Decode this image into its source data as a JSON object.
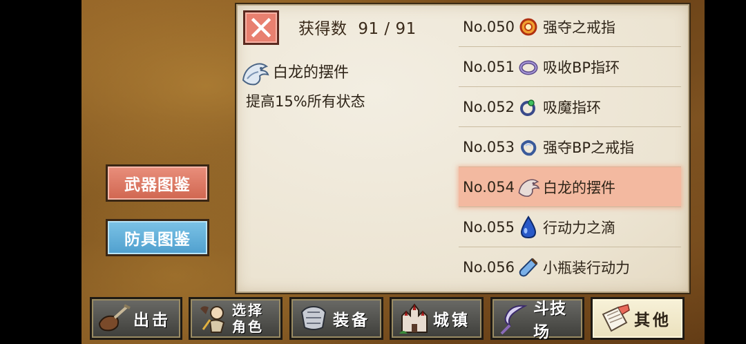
{
  "collection": {
    "count_label": "获得数",
    "count_value": "91 / 91"
  },
  "detail": {
    "name": "白龙的摆件",
    "description": "提高15%所有状态",
    "icon": "white-dragon-figurine-icon"
  },
  "items": [
    {
      "no": "No.050",
      "name": "强夺之戒指",
      "icon": "red-ring-icon"
    },
    {
      "no": "No.051",
      "name": "吸收BP指环",
      "icon": "purple-ring-icon"
    },
    {
      "no": "No.052",
      "name": "吸魔指环",
      "icon": "green-gem-ring-icon"
    },
    {
      "no": "No.053",
      "name": "强夺BP之戒指",
      "icon": "blue-ring-icon"
    },
    {
      "no": "No.054",
      "name": "白龙的摆件",
      "icon": "white-dragon-figurine-icon",
      "selected": true
    },
    {
      "no": "No.055",
      "name": "行动力之滴",
      "icon": "blue-drop-icon"
    },
    {
      "no": "No.056",
      "name": "小瓶装行动力",
      "icon": "potion-bottle-icon"
    }
  ],
  "side_buttons": {
    "weapon": "武器图鉴",
    "armor": "防具图鉴"
  },
  "nav": {
    "sortie": "出击",
    "select_line1": "选择",
    "select_line2": "角色",
    "equip": "装备",
    "town": "城镇",
    "arena": "斗技场",
    "other": "其他"
  },
  "colors": {
    "selected_row": "#f3b9a0",
    "weapon_button": "#d06650",
    "armor_button": "#4f9fce"
  }
}
